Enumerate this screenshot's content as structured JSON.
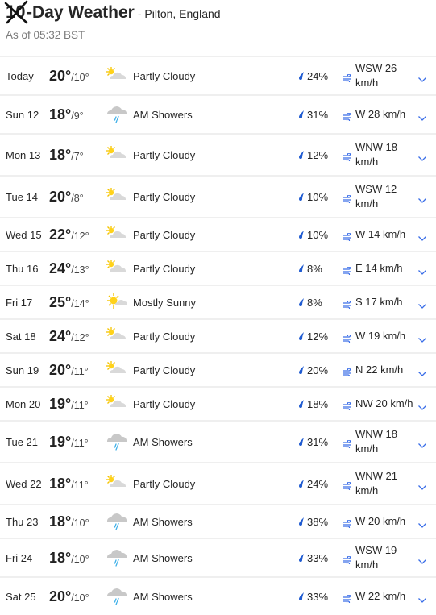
{
  "header": {
    "crossed_number": "10",
    "title": "-Day Weather",
    "location": "- Pilton, England",
    "as_of": "As of 05:32 BST"
  },
  "colors": {
    "accent": "#3a6ee8",
    "separator": "#efefef",
    "rain_drop": "#1f5bd1"
  },
  "days": [
    {
      "day": "Today",
      "hi": "20°",
      "lo": "/10°",
      "icon": "partly-cloudy-icon",
      "condition": "Partly Cloudy",
      "precip": "24%",
      "wind": "WSW 26 km/h",
      "size": "mid"
    },
    {
      "day": "Sun 12",
      "hi": "18°",
      "lo": "/9°",
      "icon": "showers-icon",
      "condition": "AM Showers",
      "precip": "31%",
      "wind": "W 28 km/h",
      "size": "mid"
    },
    {
      "day": "Mon 13",
      "hi": "18°",
      "lo": "/7°",
      "icon": "partly-cloudy-icon",
      "condition": "Partly Cloudy",
      "precip": "12%",
      "wind": "WNW 18 km/h",
      "size": "tall"
    },
    {
      "day": "Tue 14",
      "hi": "20°",
      "lo": "/8°",
      "icon": "partly-cloudy-icon",
      "condition": "Partly Cloudy",
      "precip": "10%",
      "wind": "WSW 12 km/h",
      "size": "tall"
    },
    {
      "day": "Wed 15",
      "hi": "22°",
      "lo": "/12°",
      "icon": "partly-cloudy-icon",
      "condition": "Partly Cloudy",
      "precip": "10%",
      "wind": "W 14 km/h",
      "size": "short"
    },
    {
      "day": "Thu 16",
      "hi": "24°",
      "lo": "/13°",
      "icon": "partly-cloudy-icon",
      "condition": "Partly Cloudy",
      "precip": "8%",
      "wind": "E 14 km/h",
      "size": "short"
    },
    {
      "day": "Fri 17",
      "hi": "25°",
      "lo": "/14°",
      "icon": "mostly-sunny-icon",
      "condition": "Mostly Sunny",
      "precip": "8%",
      "wind": "S 17 km/h",
      "size": "short"
    },
    {
      "day": "Sat 18",
      "hi": "24°",
      "lo": "/12°",
      "icon": "partly-cloudy-icon",
      "condition": "Partly Cloudy",
      "precip": "12%",
      "wind": "W 19 km/h",
      "size": "short"
    },
    {
      "day": "Sun 19",
      "hi": "20°",
      "lo": "/11°",
      "icon": "partly-cloudy-icon",
      "condition": "Partly Cloudy",
      "precip": "20%",
      "wind": "N 22 km/h",
      "size": "short"
    },
    {
      "day": "Mon 20",
      "hi": "19°",
      "lo": "/11°",
      "icon": "partly-cloudy-icon",
      "condition": "Partly Cloudy",
      "precip": "18%",
      "wind": "NW 20 km/h",
      "size": "short"
    },
    {
      "day": "Tue 21",
      "hi": "19°",
      "lo": "/11°",
      "icon": "showers-icon",
      "condition": "AM Showers",
      "precip": "31%",
      "wind": "WNW 18 km/h",
      "size": "tall"
    },
    {
      "day": "Wed 22",
      "hi": "18°",
      "lo": "/11°",
      "icon": "partly-cloudy-icon",
      "condition": "Partly Cloudy",
      "precip": "24%",
      "wind": "WNW 21 km/h",
      "size": "tall"
    },
    {
      "day": "Thu 23",
      "hi": "18°",
      "lo": "/10°",
      "icon": "showers-icon",
      "condition": "AM Showers",
      "precip": "38%",
      "wind": "W 20 km/h",
      "size": "short"
    },
    {
      "day": "Fri 24",
      "hi": "18°",
      "lo": "/10°",
      "icon": "showers-icon",
      "condition": "AM Showers",
      "precip": "33%",
      "wind": "WSW 19 km/h",
      "size": "mid"
    },
    {
      "day": "Sat 25",
      "hi": "20°",
      "lo": "/10°",
      "icon": "showers-icon",
      "condition": "AM Showers",
      "precip": "33%",
      "wind": "W 22 km/h",
      "size": "mid"
    }
  ]
}
